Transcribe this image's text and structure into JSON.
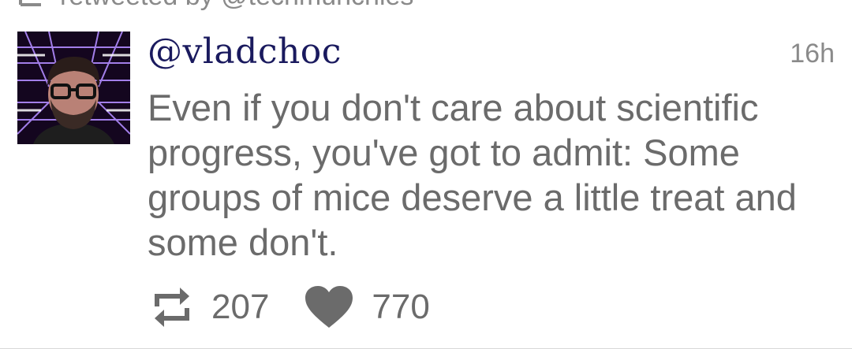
{
  "retweet_banner": {
    "text": "retweeted by @techmunchies"
  },
  "tweet": {
    "username": "@vladchoc",
    "timestamp": "16h",
    "text": "Even if you don't care about scientific progress, you've got to admit: Some groups of mice deserve a little treat and some don't.",
    "retweet_count": "207",
    "like_count": "770"
  },
  "icons": {
    "retweet": "retweet-icon",
    "like": "heart-icon"
  },
  "colors": {
    "username": "#1a1a5e",
    "body_text": "#6b6b6b",
    "meta_text": "#8a8a8a",
    "icon": "#6b6b6b"
  }
}
